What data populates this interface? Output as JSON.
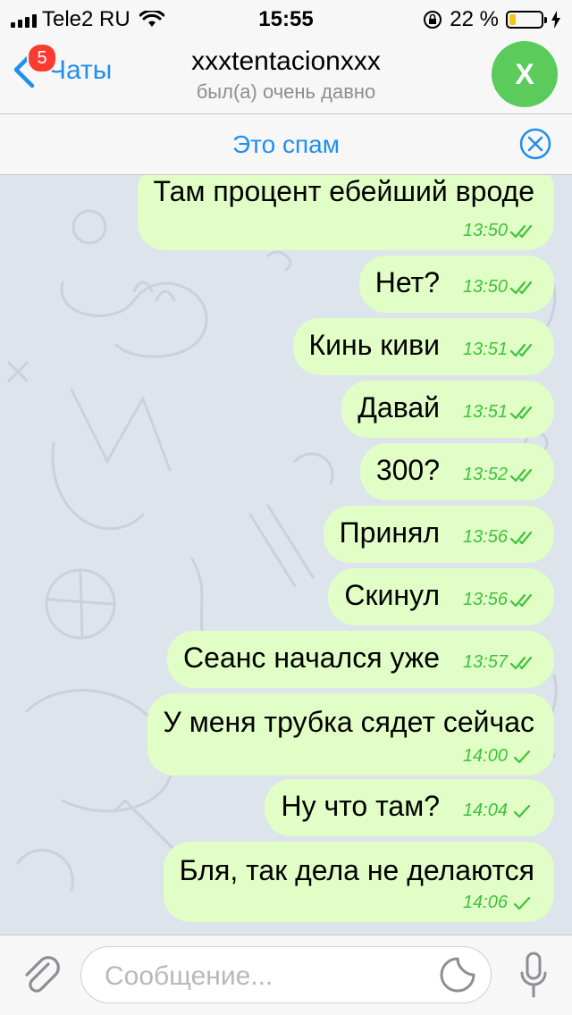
{
  "status_bar": {
    "carrier": "Tele2 RU",
    "time": "15:55",
    "battery_percent": "22 %",
    "battery_level": 0.22,
    "battery_color": "#f5c518"
  },
  "nav": {
    "back_label": "Чаты",
    "unread_badge": "5",
    "title": "xxxtentacionxxx",
    "subtitle": "был(а) очень давно",
    "avatar_initial": "X",
    "accent_color": "#1f8ff0",
    "avatar_color": "#5bcb5b"
  },
  "spam_bar": {
    "label": "Это спам"
  },
  "messages": [
    {
      "text": "Там процент ебейший вроде",
      "time": "13:50",
      "status": "read"
    },
    {
      "text": "Нет?",
      "time": "13:50",
      "status": "read"
    },
    {
      "text": "Кинь киви",
      "time": "13:51",
      "status": "read"
    },
    {
      "text": "Давай",
      "time": "13:51",
      "status": "read"
    },
    {
      "text": "300?",
      "time": "13:52",
      "status": "read"
    },
    {
      "text": "Принял",
      "time": "13:56",
      "status": "read"
    },
    {
      "text": "Скинул",
      "time": "13:56",
      "status": "read"
    },
    {
      "text": "Сеанс начался уже",
      "time": "13:57",
      "status": "read"
    },
    {
      "text": "У меня трубка сядет сейчас",
      "time": "14:00",
      "status": "sent"
    },
    {
      "text": "Ну что там?",
      "time": "14:04",
      "status": "sent"
    },
    {
      "text": "Бля, так дела не делаются",
      "time": "14:06",
      "status": "sent"
    }
  ],
  "input": {
    "placeholder": "Сообщение..."
  },
  "colors": {
    "outgoing_bubble": "#e1fec6",
    "check_color": "#3ec23f",
    "chat_background": "#dde4ec"
  },
  "icons": {
    "attach": "paperclip-icon",
    "sticker": "sticker-icon",
    "mic": "microphone-icon",
    "spam_close": "close-circle-icon",
    "back": "chevron-left-icon"
  }
}
